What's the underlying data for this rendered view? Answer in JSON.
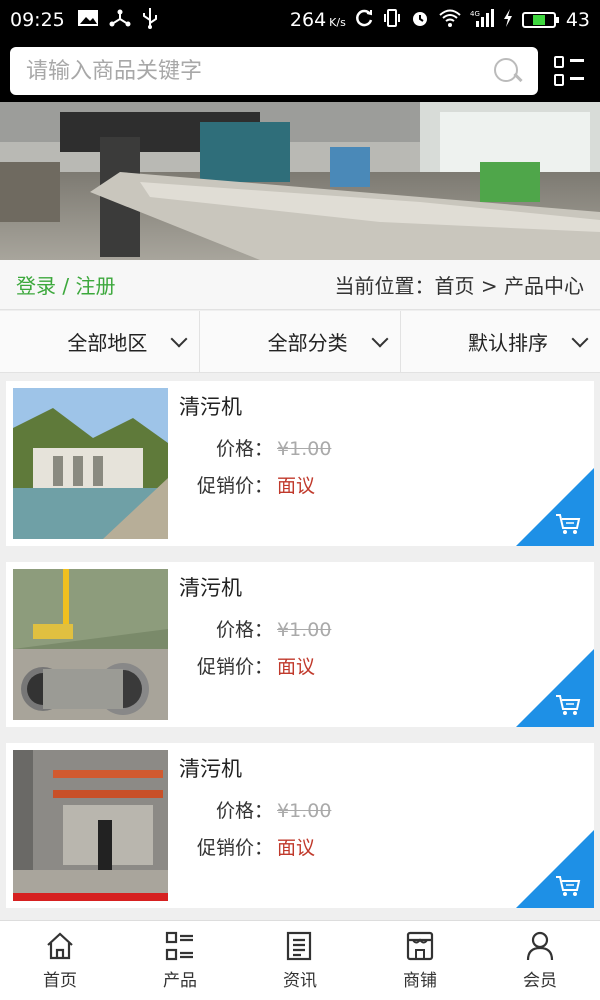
{
  "status_bar": {
    "time": "09:25",
    "speed": "264",
    "speed_unit": "K/s",
    "battery": "43",
    "icons": [
      "image-icon",
      "usb-share-icon",
      "usb-icon",
      "sync-icon",
      "vibrate-icon",
      "alarm-icon",
      "wifi-icon",
      "signal-4g-icon",
      "charging-icon",
      "battery-icon"
    ]
  },
  "search": {
    "placeholder": "请输入商品关键字"
  },
  "header": {
    "menu_icon": "grid-menu-icon"
  },
  "auth": {
    "label": "登录 / 注册"
  },
  "breadcrumb": {
    "text": "当前位置：首页 > 产品中心"
  },
  "filters": [
    {
      "label": "全部地区"
    },
    {
      "label": "全部分类"
    },
    {
      "label": "默认排序"
    }
  ],
  "products": [
    {
      "title": "清污机",
      "price_label": "价格：",
      "price": "¥1.00",
      "promo_label": "促销价：",
      "promo": "面议",
      "image": "dam-photo"
    },
    {
      "title": "清污机",
      "price_label": "价格：",
      "price": "¥1.00",
      "promo_label": "促销价：",
      "promo": "面议",
      "image": "pipe-construction-photo"
    },
    {
      "title": "清污机",
      "price_label": "价格：",
      "price": "¥1.00",
      "promo_label": "促销价：",
      "promo": "面议",
      "image": "machinery-photo"
    }
  ],
  "bottom_nav": [
    {
      "label": "首页",
      "icon": "home-icon"
    },
    {
      "label": "产品",
      "icon": "products-icon"
    },
    {
      "label": "资讯",
      "icon": "news-icon"
    },
    {
      "label": "商铺",
      "icon": "shop-icon"
    },
    {
      "label": "会员",
      "icon": "member-icon"
    }
  ],
  "colors": {
    "accent_green": "#3ca83c",
    "cart_blue": "#1e90e6",
    "promo_red": "#c0392b"
  }
}
